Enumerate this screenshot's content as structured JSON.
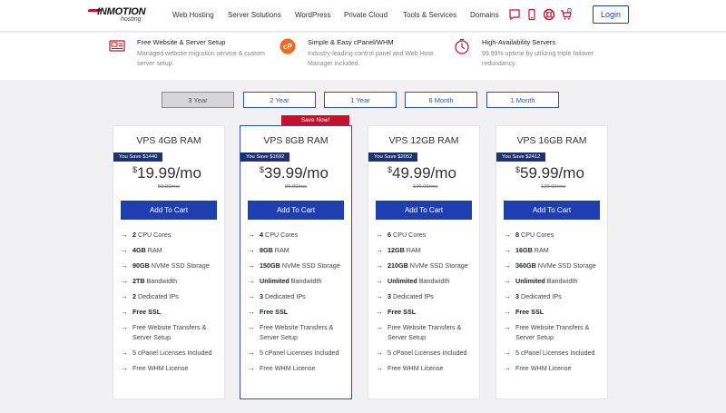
{
  "nav": {
    "logo_brand": "INMOTION",
    "logo_sub": "hosting",
    "menu": [
      "Web Hosting",
      "Server Solutions",
      "WordPress",
      "Private Cloud",
      "Tools & Services",
      "Domains"
    ],
    "cart_count": "0",
    "login_label": "Login",
    "icons": [
      "chat-icon",
      "phone-icon",
      "support-icon",
      "cart-icon"
    ]
  },
  "features": [
    {
      "title": "Free Website & Server Setup",
      "desc": "Managed website migration service & custom server setup.",
      "icon": "migration-icon"
    },
    {
      "title": "Simple & Easy cPanel/WHM",
      "desc": "Industry-leading control panel and Web Host Manager included.",
      "icon": "cpanel-icon"
    },
    {
      "title": "High-Availability Servers",
      "desc": "99.99% uptime by utilizing triple failover redundancy.",
      "icon": "uptime-icon"
    }
  ],
  "terms": [
    {
      "label": "3 Year",
      "active": true
    },
    {
      "label": "2 Year",
      "active": false
    },
    {
      "label": "1 Year",
      "active": false
    },
    {
      "label": "6 Month",
      "active": false
    },
    {
      "label": "1 Month",
      "active": false
    }
  ],
  "save_now_label": "Save Now!",
  "plans": [
    {
      "name": "VPS 4GB RAM",
      "savings": "You Save $1440",
      "currency": "$",
      "price": "19.99/mo",
      "old_price": "59.99/mo",
      "cart_label": "Add To Cart",
      "features": [
        {
          "bold": "2",
          "text": " CPU Cores"
        },
        {
          "bold": "4GB",
          "text": " RAM"
        },
        {
          "bold": "90GB",
          "text": " NVMe SSD Storage"
        },
        {
          "bold": "2TB",
          "text": " Bandwidth"
        },
        {
          "bold": "2",
          "text": " Dedicated IPs"
        },
        {
          "bold": "Free SSL",
          "text": ""
        },
        {
          "bold": "",
          "text": "Free Website Transfers & Server Setup"
        },
        {
          "bold": "",
          "text": "5 cPanel Licenses Included"
        },
        {
          "bold": "",
          "text": "Free WHM License"
        }
      ]
    },
    {
      "name": "VPS 8GB RAM",
      "savings": "You Save $1692",
      "currency": "$",
      "price": "39.99/mo",
      "old_price": "86.99/mo",
      "cart_label": "Add To Cart",
      "features": [
        {
          "bold": "4",
          "text": " CPU Cores"
        },
        {
          "bold": "8GB",
          "text": " RAM"
        },
        {
          "bold": "150GB",
          "text": " NVMe SSD Storage"
        },
        {
          "bold": "Unlimited",
          "text": " Bandwidth"
        },
        {
          "bold": "3",
          "text": " Dedicated IPs"
        },
        {
          "bold": "Free SSL",
          "text": ""
        },
        {
          "bold": "",
          "text": "Free Website Transfers & Server Setup"
        },
        {
          "bold": "",
          "text": "5 cPanel Licenses Included"
        },
        {
          "bold": "",
          "text": "Free WHM License"
        }
      ]
    },
    {
      "name": "VPS 12GB RAM",
      "savings": "You Save $2052",
      "currency": "$",
      "price": "49.99/mo",
      "old_price": "106.99/mo",
      "cart_label": "Add To Cart",
      "features": [
        {
          "bold": "6",
          "text": " CPU Cores"
        },
        {
          "bold": "12GB",
          "text": " RAM"
        },
        {
          "bold": "210GB",
          "text": " NVMe SSD Storage"
        },
        {
          "bold": "Unlimited",
          "text": " Bandwidth"
        },
        {
          "bold": "3",
          "text": " Dedicated IPs"
        },
        {
          "bold": "Free SSL",
          "text": ""
        },
        {
          "bold": "",
          "text": "Free Website Transfers & Server Setup"
        },
        {
          "bold": "",
          "text": "5 cPanel Licenses Included"
        },
        {
          "bold": "",
          "text": "Free WHM License"
        }
      ]
    },
    {
      "name": "VPS 16GB RAM",
      "savings": "You Save $2412",
      "currency": "$",
      "price": "59.99/mo",
      "old_price": "126.99/mo",
      "cart_label": "Add To Cart",
      "features": [
        {
          "bold": "8",
          "text": " CPU Cores"
        },
        {
          "bold": "16GB",
          "text": " RAM"
        },
        {
          "bold": "360GB",
          "text": " NVMe SSD Storage"
        },
        {
          "bold": "Unlimited",
          "text": " Bandwidth"
        },
        {
          "bold": "3",
          "text": " Dedicated IPs"
        },
        {
          "bold": "Free SSL",
          "text": ""
        },
        {
          "bold": "",
          "text": "Free Website Transfers & Server Setup"
        },
        {
          "bold": "",
          "text": "5 cPanel Licenses Included"
        },
        {
          "bold": "",
          "text": "Free WHM License"
        }
      ]
    }
  ],
  "colors": {
    "brand_red": "#c8102e",
    "brand_blue": "#1f3fb0",
    "savings_navy": "#1e3170"
  }
}
